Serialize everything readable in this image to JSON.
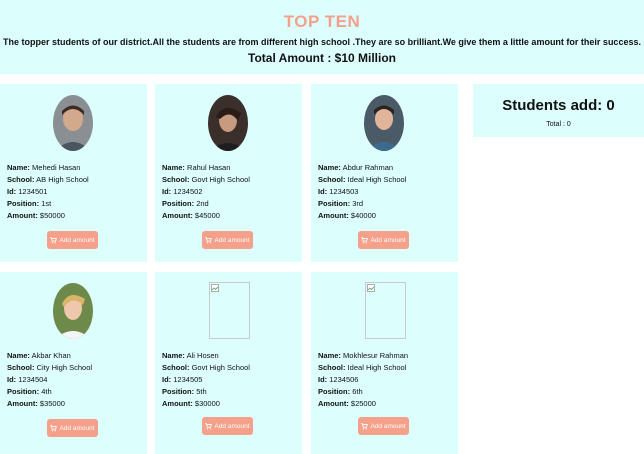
{
  "header": {
    "title": "TOP TEN",
    "description": "The topper students of our district.All the students are from different high school .They are so brilliant.We give them a little amount for their success.",
    "total_amount": "Total Amount : $10 Million"
  },
  "labels": {
    "name": "Name:",
    "school": "School:",
    "id": "Id:",
    "position": "Position:",
    "amount": "Amount:"
  },
  "students": [
    {
      "name": "Mehedi Hasan",
      "school": "AB High School",
      "id": "1234501",
      "position": "1st",
      "amount": "$50000",
      "button": "Add amount",
      "photo": "male-photo"
    },
    {
      "name": "Rahul Hasan",
      "school": "Govt High School",
      "id": "1234502",
      "position": "2nd",
      "amount": "$45000",
      "button": "Add amount",
      "photo": "male-photo"
    },
    {
      "name": "Abdur Rahman",
      "school": "Ideal High School",
      "id": "1234503",
      "position": "3rd",
      "amount": "$40000",
      "button": "Add amount",
      "photo": "male-photo"
    },
    {
      "name": "Akbar Khan",
      "school": "City High School",
      "id": "1234504",
      "position": "4th",
      "amount": "$35000",
      "button": "Add amount",
      "photo": "male-photo"
    },
    {
      "name": "Ali Hosen",
      "school": "Govt High School",
      "id": "1234505",
      "position": "5th",
      "amount": "$30000",
      "button": "Add amount",
      "photo": "broken-image"
    },
    {
      "name": "Mokhlesur Rahman",
      "school": "Ideal High School",
      "id": "1234506",
      "position": "6th",
      "amount": "$25000",
      "button": "Add amount",
      "photo": "broken-image"
    }
  ],
  "summary": {
    "title": "Students add: 0",
    "total": "Total : 0"
  },
  "colors": {
    "card_bg": "#dcfffe",
    "accent": "#f4a08a"
  }
}
